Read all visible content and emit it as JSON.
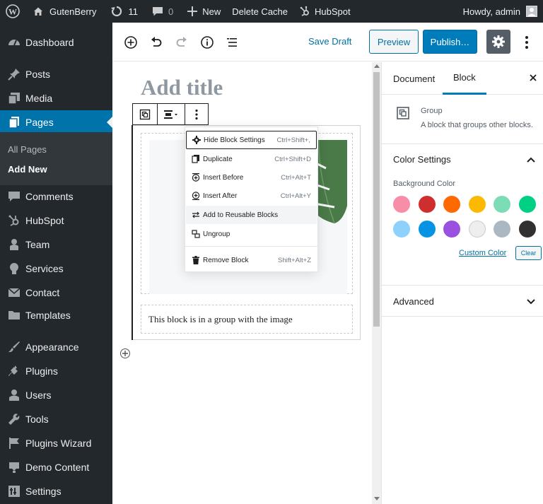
{
  "adminbar": {
    "site_name": "GutenBerry",
    "updates_count": "11",
    "comments_count": "0",
    "new_label": "New",
    "delete_cache_label": "Delete Cache",
    "hubspot_label": "HubSpot",
    "howdy": "Howdy, admin"
  },
  "menu": {
    "items": [
      {
        "label": "Dashboard",
        "icon": "dashboard-icon"
      },
      {
        "label": "Posts",
        "icon": "pin-icon"
      },
      {
        "label": "Media",
        "icon": "media-icon"
      },
      {
        "label": "Pages",
        "icon": "pages-icon"
      },
      {
        "label": "Comments",
        "icon": "comment-icon"
      },
      {
        "label": "HubSpot",
        "icon": "hubspot-icon"
      },
      {
        "label": "Team",
        "icon": "person-icon"
      },
      {
        "label": "Services",
        "icon": "lightbulb-icon"
      },
      {
        "label": "Contact",
        "icon": "envelope-icon"
      },
      {
        "label": "Templates",
        "icon": "folder-icon"
      },
      {
        "label": "Appearance",
        "icon": "brush-icon"
      },
      {
        "label": "Plugins",
        "icon": "plugin-icon"
      },
      {
        "label": "Users",
        "icon": "users-icon"
      },
      {
        "label": "Tools",
        "icon": "wrench-icon"
      },
      {
        "label": "Plugins Wizard",
        "icon": "flag-icon"
      },
      {
        "label": "Demo Content",
        "icon": "download-icon"
      },
      {
        "label": "Settings",
        "icon": "settings-icon"
      }
    ],
    "submenu": {
      "all_pages": "All Pages",
      "add_new": "Add New"
    }
  },
  "editor": {
    "save_draft": "Save Draft",
    "preview": "Preview",
    "publish": "Publish…",
    "title_placeholder": "Add title",
    "paragraph_text": "This block is in a group with the image"
  },
  "block_menu": {
    "items": [
      {
        "label": "Hide Block Settings",
        "shortcut": "Ctrl+Shift+,"
      },
      {
        "label": "Duplicate",
        "shortcut": "Ctrl+Shift+D"
      },
      {
        "label": "Insert Before",
        "shortcut": "Ctrl+Alt+T"
      },
      {
        "label": "Insert After",
        "shortcut": "Ctrl+Alt+Y"
      },
      {
        "label": "Add to Reusable Blocks",
        "shortcut": ""
      },
      {
        "label": "Ungroup",
        "shortcut": ""
      },
      {
        "label": "Remove Block",
        "shortcut": "Shift+Alt+Z"
      }
    ]
  },
  "sidebar": {
    "tabs": {
      "document": "Document",
      "block": "Block"
    },
    "block_title": "Group",
    "block_description": "A block that groups other blocks.",
    "color_settings": "Color Settings",
    "background_color": "Background Color",
    "custom_color": "Custom Color",
    "clear": "Clear",
    "advanced": "Advanced",
    "swatches": [
      "#f78da7",
      "#cf2e2e",
      "#ff6900",
      "#fcb900",
      "#7bdcb5",
      "#00d084",
      "#8ed1fc",
      "#0693e3",
      "#9b51e0",
      "#eeeeee",
      "#abb8c3",
      "#313131"
    ]
  },
  "colors": {
    "admin_bg": "#23282d",
    "accent": "#0073aa",
    "publish": "#007cba"
  }
}
